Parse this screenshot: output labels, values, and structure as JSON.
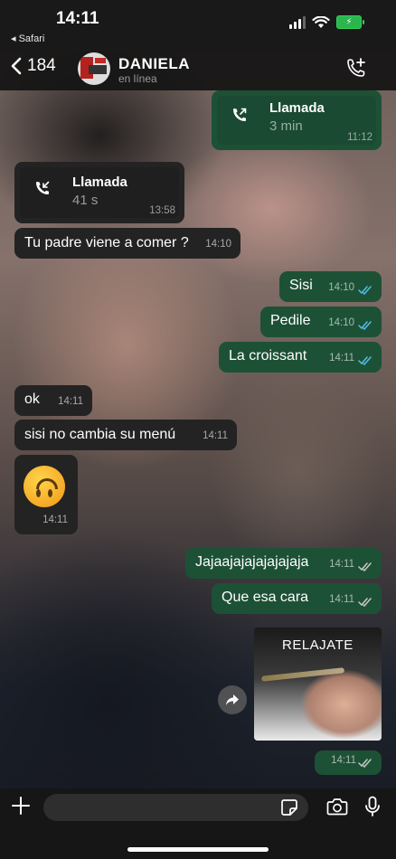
{
  "status_bar": {
    "time": "14:11",
    "back_app": "◂ Safari",
    "battery_glyph": "⚡"
  },
  "header": {
    "back_count": "184",
    "contact_name": "DANIELA",
    "contact_status": "en línea",
    "icons": [
      "chevron-left-icon",
      "avatar",
      "add-call-icon"
    ]
  },
  "messages": {
    "call_out": {
      "title": "Llamada",
      "duration": "3 min",
      "time": "11:12"
    },
    "call_in": {
      "title": "Llamada",
      "duration": "41 s",
      "time": "13:58"
    },
    "m1": {
      "text": "Tu padre viene a comer ?",
      "time": "14:10"
    },
    "m2": {
      "text": "Sisi",
      "time": "14:10"
    },
    "m3": {
      "text": "Pedile",
      "time": "14:10"
    },
    "m4": {
      "text": "La croissant",
      "time": "14:11"
    },
    "m5": {
      "text": "ok",
      "time": "14:11"
    },
    "m6": {
      "text": "sisi no cambia su menú",
      "time": "14:11"
    },
    "m7": {
      "emoji": "upside-down-face",
      "time": "14:11"
    },
    "m8": {
      "text": "Jajaajajajajajajaja",
      "time": "14:11"
    },
    "m9": {
      "text": "Que esa cara",
      "time": "14:11"
    },
    "m10": {
      "sticker_label": "RELAJATE",
      "time": "14:11"
    }
  },
  "composer": {
    "placeholder": "",
    "value": ""
  },
  "colors": {
    "outgoing": "#1d5136",
    "incoming": "#232323",
    "read_tick": "#53bdeb",
    "delivered_tick": "#c8c8c8"
  }
}
